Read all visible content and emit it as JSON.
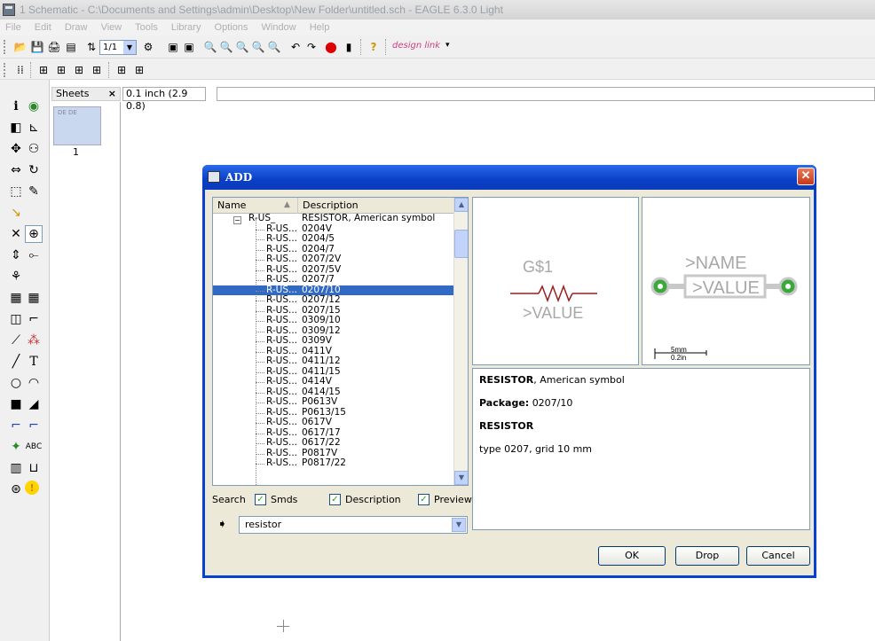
{
  "window": {
    "title": "1 Schematic - C:\\Documents and Settings\\admin\\Desktop\\New Folder\\untitled.sch - EAGLE 6.3.0 Light"
  },
  "menu": [
    "File",
    "Edit",
    "Draw",
    "View",
    "Tools",
    "Library",
    "Options",
    "Window",
    "Help"
  ],
  "toolbar": {
    "zoom_select": "1/1",
    "designlink": "design link"
  },
  "sheets": {
    "label": "Sheets",
    "close": "×",
    "sheet_number": "1",
    "thumb_text": "DE DE"
  },
  "coord_readout": "0.1 inch (2.9 0.8)",
  "dialog": {
    "title": "ADD",
    "close": "✕",
    "columns": {
      "name": "Name",
      "description": "Description"
    },
    "parent": {
      "name": "R-US_",
      "description": "RESISTOR, American symbol"
    },
    "rows": [
      {
        "name": "R-US...",
        "desc": "0204V"
      },
      {
        "name": "R-US...",
        "desc": "0204/5"
      },
      {
        "name": "R-US...",
        "desc": "0204/7"
      },
      {
        "name": "R-US...",
        "desc": "0207/2V"
      },
      {
        "name": "R-US...",
        "desc": "0207/5V"
      },
      {
        "name": "R-US...",
        "desc": "0207/7"
      },
      {
        "name": "R-US...",
        "desc": "0207/10"
      },
      {
        "name": "R-US...",
        "desc": "0207/12"
      },
      {
        "name": "R-US...",
        "desc": "0207/15"
      },
      {
        "name": "R-US...",
        "desc": "0309/10"
      },
      {
        "name": "R-US...",
        "desc": "0309/12"
      },
      {
        "name": "R-US...",
        "desc": "0309V"
      },
      {
        "name": "R-US...",
        "desc": "0411V"
      },
      {
        "name": "R-US...",
        "desc": "0411/12"
      },
      {
        "name": "R-US...",
        "desc": "0411/15"
      },
      {
        "name": "R-US...",
        "desc": "0414V"
      },
      {
        "name": "R-US...",
        "desc": "0414/15"
      },
      {
        "name": "R-US...",
        "desc": "P0613V"
      },
      {
        "name": "R-US...",
        "desc": "P0613/15"
      },
      {
        "name": "R-US...",
        "desc": "0617V"
      },
      {
        "name": "R-US...",
        "desc": "0617/17"
      },
      {
        "name": "R-US...",
        "desc": "0617/22"
      },
      {
        "name": "R-US...",
        "desc": "P0817V"
      },
      {
        "name": "R-US...",
        "desc": "P0817/22"
      }
    ],
    "selected_desc": "0207/10",
    "symbol_preview": {
      "name": "G$1",
      "value": ">VALUE"
    },
    "package_preview": {
      "name": ">NAME",
      "value": ">VALUE",
      "scale_mm": "5mm",
      "scale_in": "0.2in"
    },
    "description": {
      "line1_bold": "RESISTOR",
      "line1_rest": ", American symbol",
      "package_label": "Package:",
      "package_value": "0207/10",
      "heading": "RESISTOR",
      "detail": "type 0207, grid 10 mm"
    },
    "search_label": "Search",
    "options": {
      "smds": "Smds",
      "description": "Description",
      "preview": "Preview"
    },
    "search_value": "resistor",
    "buttons": {
      "ok": "OK",
      "drop": "Drop",
      "cancel": "Cancel"
    }
  }
}
